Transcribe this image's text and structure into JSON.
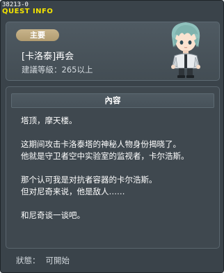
{
  "window": {
    "quest_id": "38213-0",
    "title": "QUEST INFO"
  },
  "header": {
    "badge_label": "主要",
    "quest_name": "[卡洛泰]再会",
    "level_requirement": "建議等級：265以上",
    "npc_icon": "npc-portrait-icon"
  },
  "content": {
    "section_title": "內容",
    "lines": [
      "塔顶，摩天楼。",
      "",
      "这期间攻击卡洛泰塔的神秘人物身份揭晓了。",
      "他就是守卫者空中实验室的监视者，卡尔浩斯。",
      "",
      "那个认可我是对抗者容器的卡尔浩斯。",
      "但对尼奇来说，他是敌人……",
      "",
      "和尼奇谈一谈吧。"
    ]
  },
  "status": {
    "label": "狀態：",
    "value": "可開始"
  },
  "colors": {
    "background": "#3a434a",
    "title": "#f4e400",
    "badge": "#bca77c",
    "text": "#ffffff"
  }
}
